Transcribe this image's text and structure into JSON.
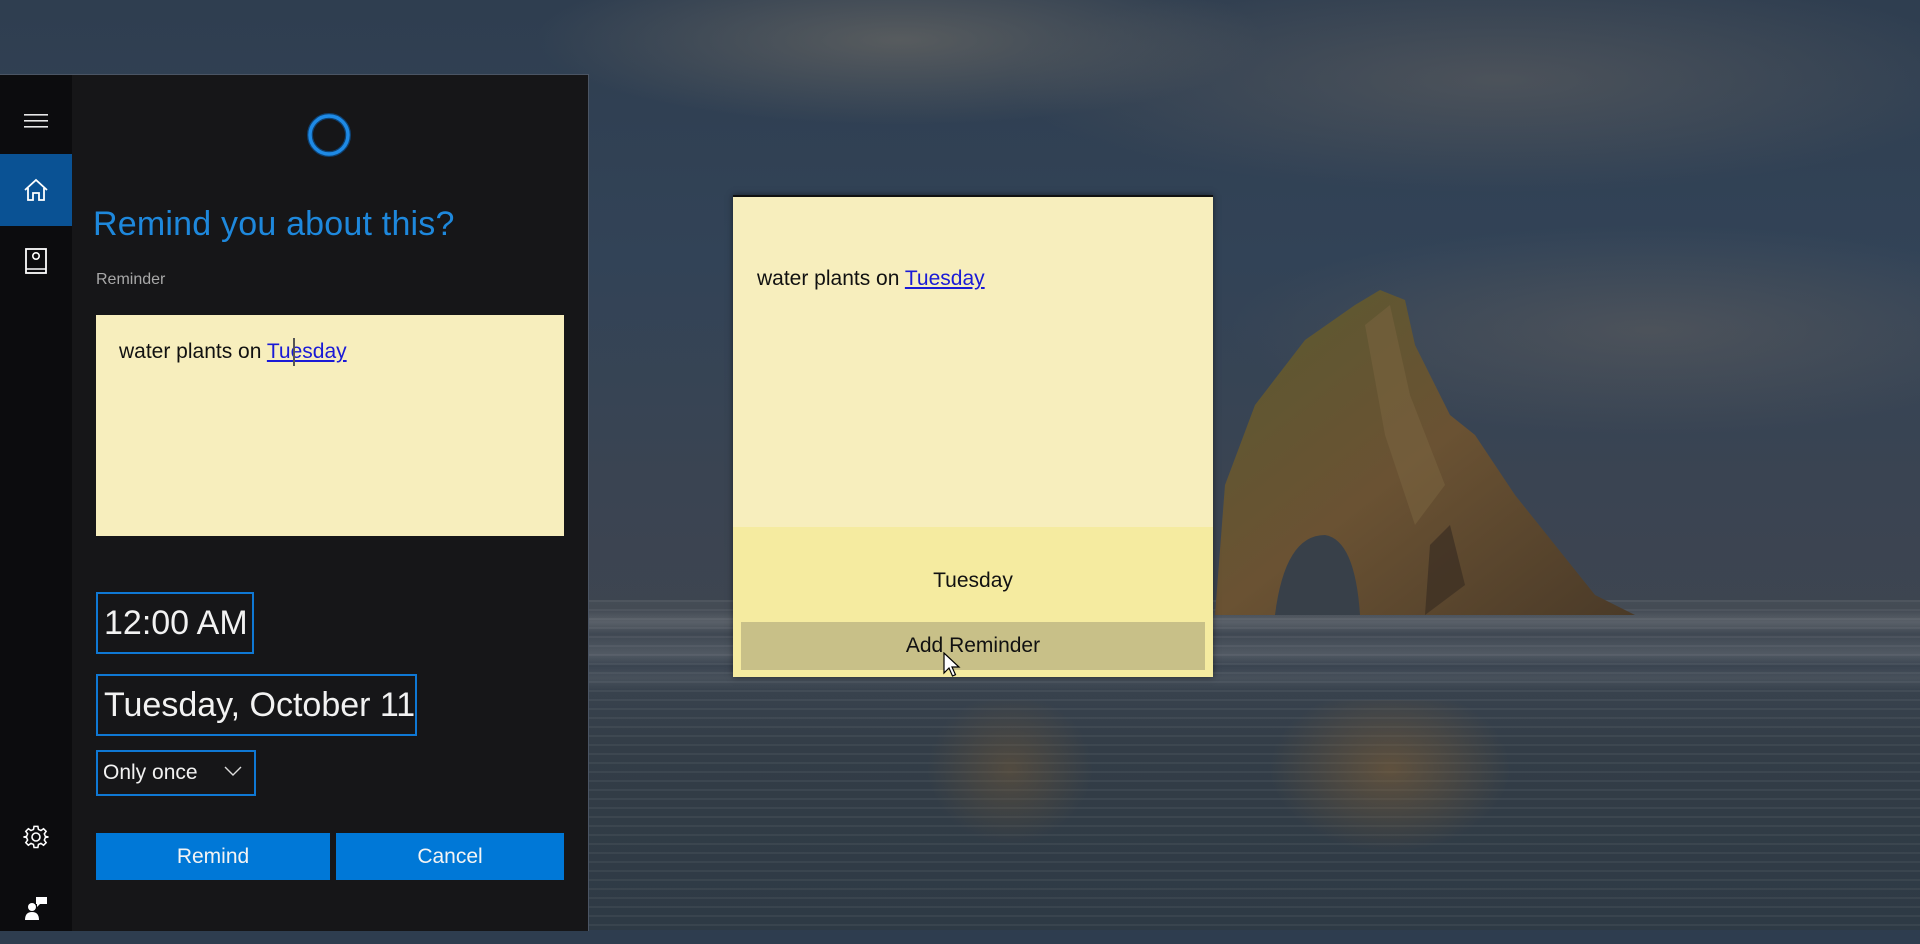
{
  "window": {
    "app": "Cortana"
  },
  "sidebar": {
    "items": [
      {
        "name": "menu",
        "icon": "hamburger-menu-icon",
        "active": false
      },
      {
        "name": "home",
        "icon": "home-icon",
        "active": true
      },
      {
        "name": "notebook",
        "icon": "notebook-icon",
        "active": false
      },
      {
        "name": "settings",
        "icon": "gear-icon",
        "active": false
      },
      {
        "name": "feedback",
        "icon": "feedback-icon",
        "active": false
      }
    ]
  },
  "cortana": {
    "title": "Remind you about this?",
    "reminder_label": "Reminder",
    "note": {
      "text_before_link": "water plants on ",
      "link_text": "Tuesday"
    },
    "time_value": "12:00 AM",
    "date_value": "Tuesday, October 11",
    "repeat": {
      "selected": "Only once"
    },
    "remind_button": "Remind",
    "cancel_button": "Cancel",
    "colors": {
      "accent": "#0078d7",
      "title": "#1e88dc",
      "note_bg": "#f7eebd"
    }
  },
  "sticky_note": {
    "text_before_link": "water plants on ",
    "link_text": "Tuesday",
    "detected_day": "Tuesday",
    "add_reminder_button": "Add Reminder",
    "colors": {
      "note_bg": "#f7eebd",
      "bottom_bg": "#f5eba0",
      "button_bg": "#c8c088",
      "link": "#1a1ad6"
    }
  }
}
